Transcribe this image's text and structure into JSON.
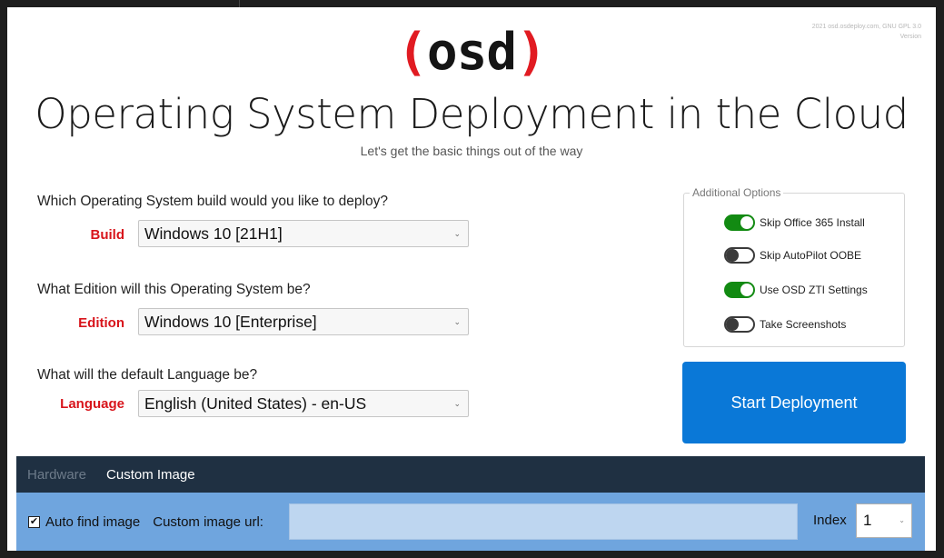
{
  "header": {
    "version_line1": "2021 osd.osdeploy.com, GNU GPL 3.0",
    "version_line2": "Version",
    "logo_paren_open": "(",
    "logo_word": "osd",
    "logo_paren_close": ")",
    "title": "Operating System Deployment in the Cloud",
    "subtitle": "Let's get the basic things out of the way"
  },
  "build": {
    "question": "Which Operating System build would you like to deploy?",
    "label": "Build",
    "value": "Windows 10 [21H1]"
  },
  "edition": {
    "question": "What Edition will this Operating System be?",
    "label": "Edition",
    "value": "Windows 10 [Enterprise]"
  },
  "language": {
    "question": "What will the default Language be?",
    "label": "Language",
    "value": "English (United States) - en-US"
  },
  "options": {
    "legend": "Additional Options",
    "items": [
      {
        "label": "Skip Office 365 Install",
        "on": true
      },
      {
        "label": "Skip AutoPilot OOBE",
        "on": false
      },
      {
        "label": "Use OSD ZTI Settings",
        "on": true
      },
      {
        "label": "Take Screenshots",
        "on": false
      }
    ]
  },
  "start_button": "Start Deployment",
  "tabs": [
    {
      "label": "Hardware",
      "active": false
    },
    {
      "label": "Custom Image",
      "active": true
    }
  ],
  "custom_image": {
    "auto_find_label": "Auto find image",
    "auto_find_checked": true,
    "url_label": "Custom image url:",
    "url_value": "",
    "index_label": "Index",
    "index_value": "1"
  },
  "colors": {
    "accent_red": "#e11b22",
    "label_red": "#d8141b",
    "primary_blue": "#0a78d7",
    "toggle_green": "#128a12",
    "tabbar_bg": "#1f3042",
    "panel_bg": "#6fa5de"
  }
}
